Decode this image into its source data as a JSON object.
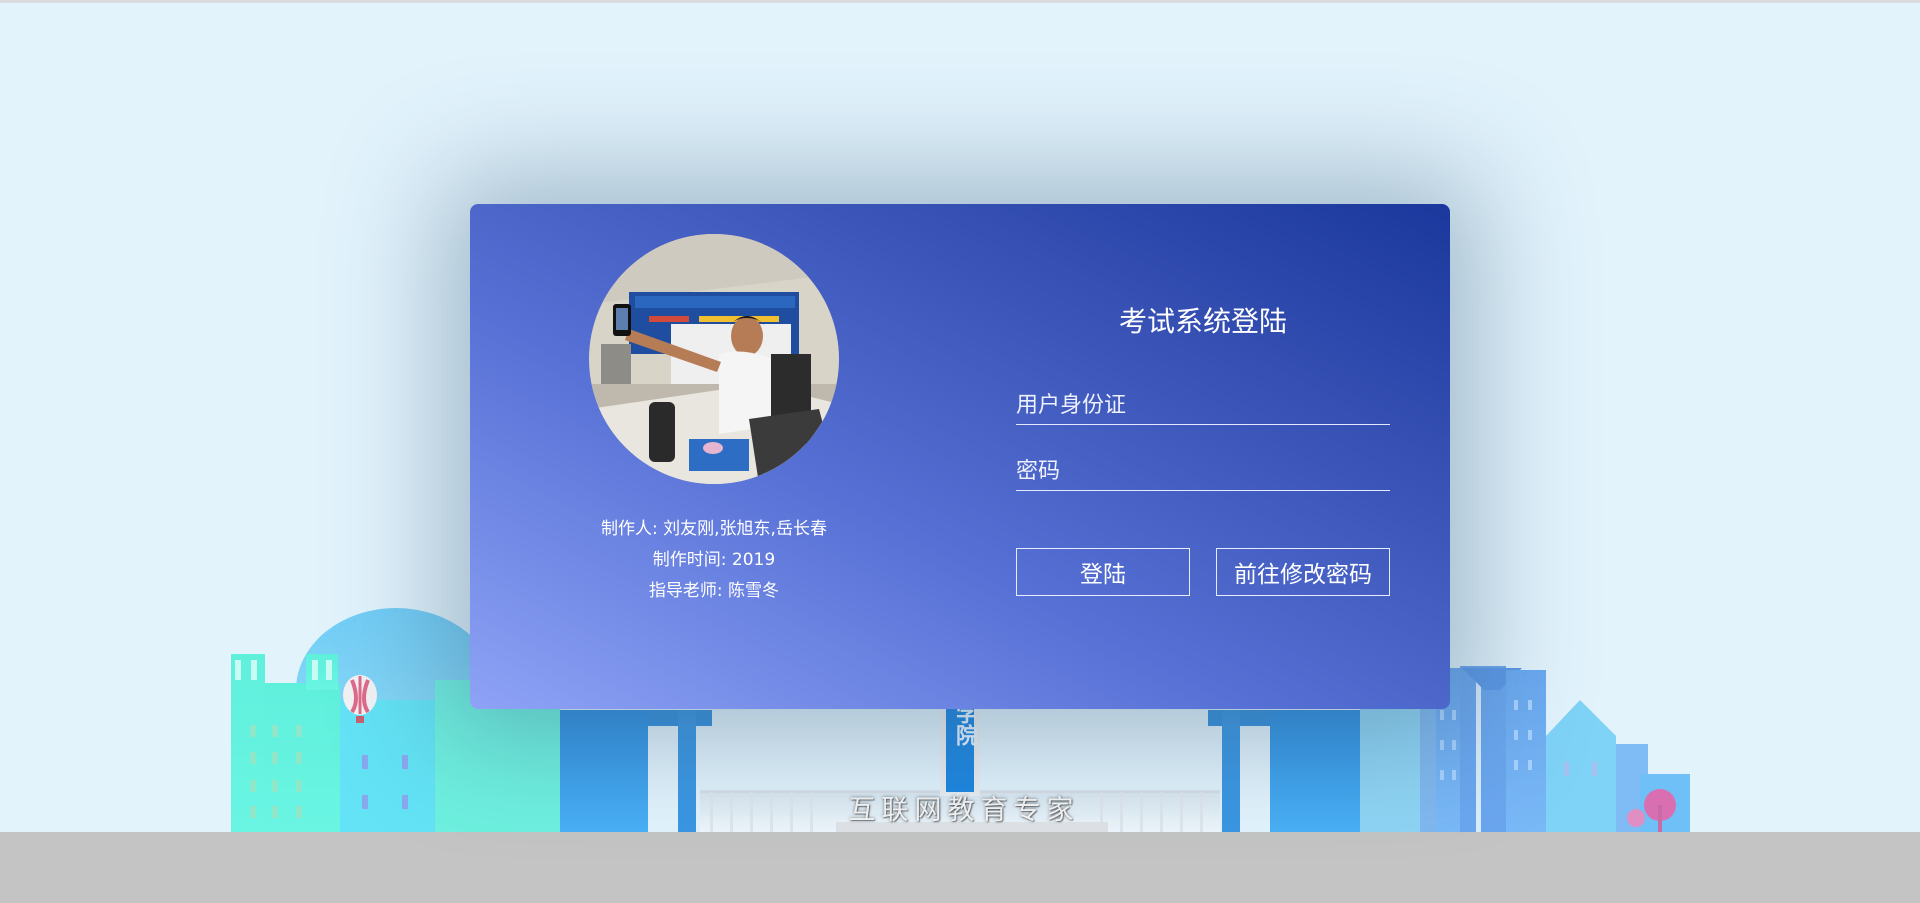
{
  "login": {
    "title": "考试系统登陆",
    "id_placeholder": "用户身份证",
    "password_placeholder": "密码",
    "login_button": "登陆",
    "change_password_button": "前往修改密码"
  },
  "credits": {
    "makers": "制作人: 刘友刚,张旭东,岳长春",
    "date": "制作时间: 2019",
    "advisor": "指导老师: 陈雪冬"
  },
  "background": {
    "slogan": "互联网教育专家",
    "tower_sign": "学院"
  },
  "colors": {
    "page_bg": "#e2f3fc",
    "card_gradient_start": "#8ea3f6",
    "card_gradient_end": "#1a389d",
    "ground": "#c4c4c4"
  }
}
